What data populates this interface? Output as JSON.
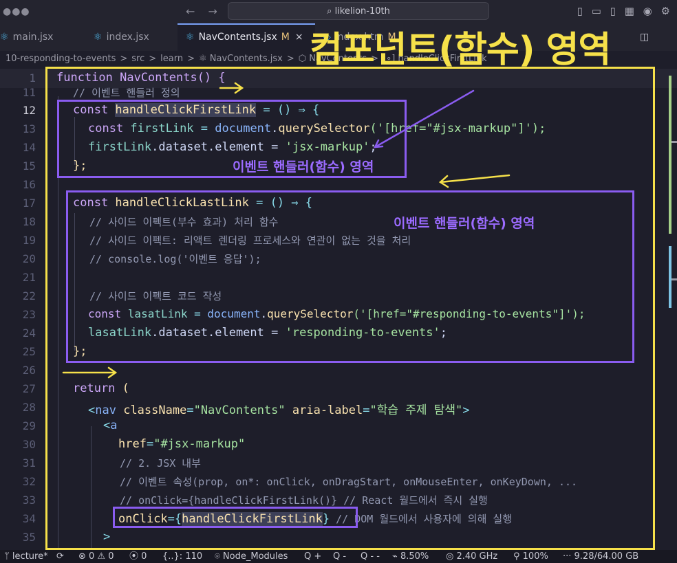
{
  "titlebar": {
    "search_text": "⌕ likelion-10th",
    "window_dots": "●●●",
    "nav_back": "←",
    "nav_forward": "→",
    "icons": [
      "sidebar-left-icon",
      "panel-icon",
      "sidebar-right-icon",
      "layout-icon",
      "account-icon",
      "gear-icon"
    ]
  },
  "tabs": [
    {
      "label": "main.jsx"
    },
    {
      "label": "index.jsx"
    },
    {
      "label": "NavContents.jsx",
      "modified": "M",
      "close": "×"
    },
    {
      "label": "index.htm",
      "modified": "M"
    }
  ],
  "breadcrumb": [
    "10-responding-to-events",
    ">",
    "src",
    ">",
    "learn",
    ">",
    "⚛ NavContents.jsx",
    ">",
    "⬡ NavContents",
    ">",
    "[∘] handleClickFirstLink"
  ],
  "code": {
    "line_numbers": [
      "1",
      "11",
      "12",
      "13",
      "14",
      "15",
      "16",
      "17",
      "18",
      "19",
      "20",
      "21",
      "22",
      "23",
      "24",
      "25",
      "26",
      "27",
      "28",
      "29",
      "30",
      "31",
      "32",
      "33",
      "34",
      "35"
    ],
    "sticky_line": "function NavContents() {",
    "line11": "// 이벤트 핸들러 정의",
    "line12a": "const ",
    "line12b": "handleClickFirstLink",
    "line12c": " = () ⇒ {",
    "line13a": "const ",
    "line13b": "firstLink",
    "line13c": " = ",
    "line13d": "document",
    "line13e": ".",
    "line13f": "querySelector",
    "line13g": "('[href=\"#jsx-markup\"]');",
    "line14a": "firstLink",
    "line14b": ".dataset.element = ",
    "line14c": "'jsx-markup'",
    "line14d": ";",
    "line15": "};",
    "line17a": "const ",
    "line17b": "handleClickLastLink",
    "line17c": " = () ⇒ {",
    "line18": "// 사이드 이펙트(부수 효과) 처리 함수",
    "line19": "// 사이드 이펙트: 리액트 렌더링 프로세스와 연관이 없는 것을 처리",
    "line20": "// console.log('이벤트 응답');",
    "line22": "// 사이드 이펙트 코드 작성",
    "line23a": "const ",
    "line23b": "lasatLink",
    "line23c": " = ",
    "line23d": "document",
    "line23e": ".",
    "line23f": "querySelector",
    "line23g": "('[href=\"#responding-to-events\"]');",
    "line24a": "lasatLink",
    "line24b": ".dataset.element = ",
    "line24c": "'responding-to-events'",
    "line24d": ";",
    "line25": "};",
    "line27a": "return",
    "line27b": " (",
    "line28a": "<",
    "line28b": "nav",
    "line28c": " className",
    "line28d": "=",
    "line28e": "\"NavContents\"",
    "line28f": " aria-label",
    "line28g": "=",
    "line28h": "\"학습 주제 탐색\"",
    "line28i": ">",
    "line29a": "<",
    "line29b": "a",
    "line30a": "href",
    "line30b": "=",
    "line30c": "\"#jsx-markup\"",
    "line31": "// 2. JSX 내부",
    "line32": "// 이벤트 속성(prop, on*: onClick, onDragStart, onMouseEnter, onKeyDown, ...",
    "line33": "// onClick={handleClickFirstLink()} // React 월드에서 즉시 실행",
    "line34a": "onClick",
    "line34b": "={",
    "line34c": "handleClickFirstLink",
    "line34d": "}",
    "line34e": " // DOM 월드에서 사용자에 의해 실행",
    "line35": ">"
  },
  "annotations": {
    "component_area": "컴포넌트(함수) 영역",
    "handler_area_1": "이벤트 핸들러(함수) 영역",
    "handler_area_2": "이벤트 핸들러(함수) 영역"
  },
  "statusbar": {
    "branch": "ᛘ lecture*",
    "sync": "⟳",
    "problems": "⊗ 0 ⚠ 0",
    "ports": "⦿ 0",
    "selection": "{..}: 110",
    "node_modules": "⌾ Node_Modules",
    "q1": "Q +",
    "q2": "Q -",
    "q3": "Q - -",
    "cpu": "⌁ 8.50%",
    "ghz": "◎ 2.40 GHz",
    "battery": "⚲ 100%",
    "memory": "··· 9.28/64.00 GB"
  },
  "colors": {
    "annotation_yellow": "#f6e14a",
    "annotation_purple": "#8a5cf0",
    "background": "#1e1e2a"
  }
}
